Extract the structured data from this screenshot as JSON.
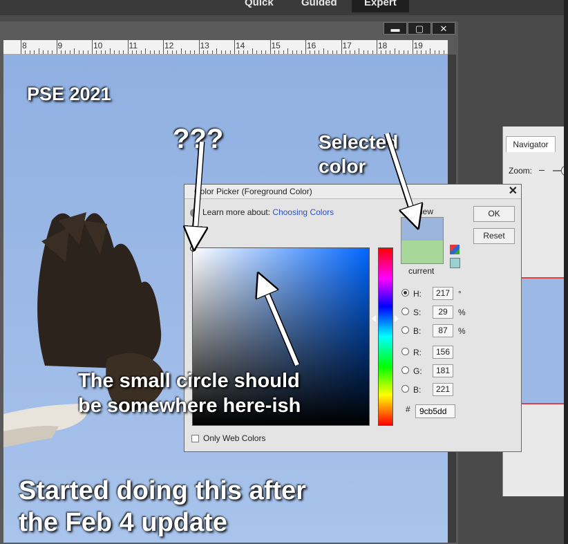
{
  "modes": {
    "quick": "Quick",
    "guided": "Guided",
    "expert": "Expert"
  },
  "window_buttons": {
    "minimize": "▬",
    "maximize": "▢",
    "close": "✕"
  },
  "ruler_labels": [
    "8",
    "9",
    "10",
    "11",
    "12",
    "13",
    "14",
    "15",
    "16",
    "17",
    "18",
    "19"
  ],
  "annotations": {
    "corner": "PSE 2021",
    "question": "???",
    "selected_line1": "Selected",
    "selected_line2": "color",
    "circle_line1": "The small circle should",
    "circle_line2": "be somewhere here-ish",
    "footer_line1": "Started doing this after",
    "footer_line2": "the Feb 4 update"
  },
  "navigator": {
    "tab": "Navigator",
    "zoom_label": "Zoom:"
  },
  "dialog": {
    "title": "Color Picker (Foreground Color)",
    "close": "✕",
    "learn_text": "Learn more about:",
    "learn_link": "Choosing Colors",
    "new_label": "new",
    "current_label": "current",
    "ok": "OK",
    "reset": "Reset",
    "fields": {
      "h": {
        "label": "H:",
        "value": "217",
        "unit": "°"
      },
      "s": {
        "label": "S:",
        "value": "29",
        "unit": "%"
      },
      "b": {
        "label": "B:",
        "value": "87",
        "unit": "%"
      },
      "r": {
        "label": "R:",
        "value": "156"
      },
      "g": {
        "label": "G:",
        "value": "181"
      },
      "bb": {
        "label": "B:",
        "value": "221"
      }
    },
    "hex_label": "#",
    "hex_value": "9cb5dd",
    "web_only": "Only Web Colors",
    "selected_field": "h"
  },
  "colors": {
    "new": "#9cb5dd",
    "current": "#a8d79a",
    "websafe": "#9cd0d0",
    "hue_pure": "#0066ff"
  }
}
